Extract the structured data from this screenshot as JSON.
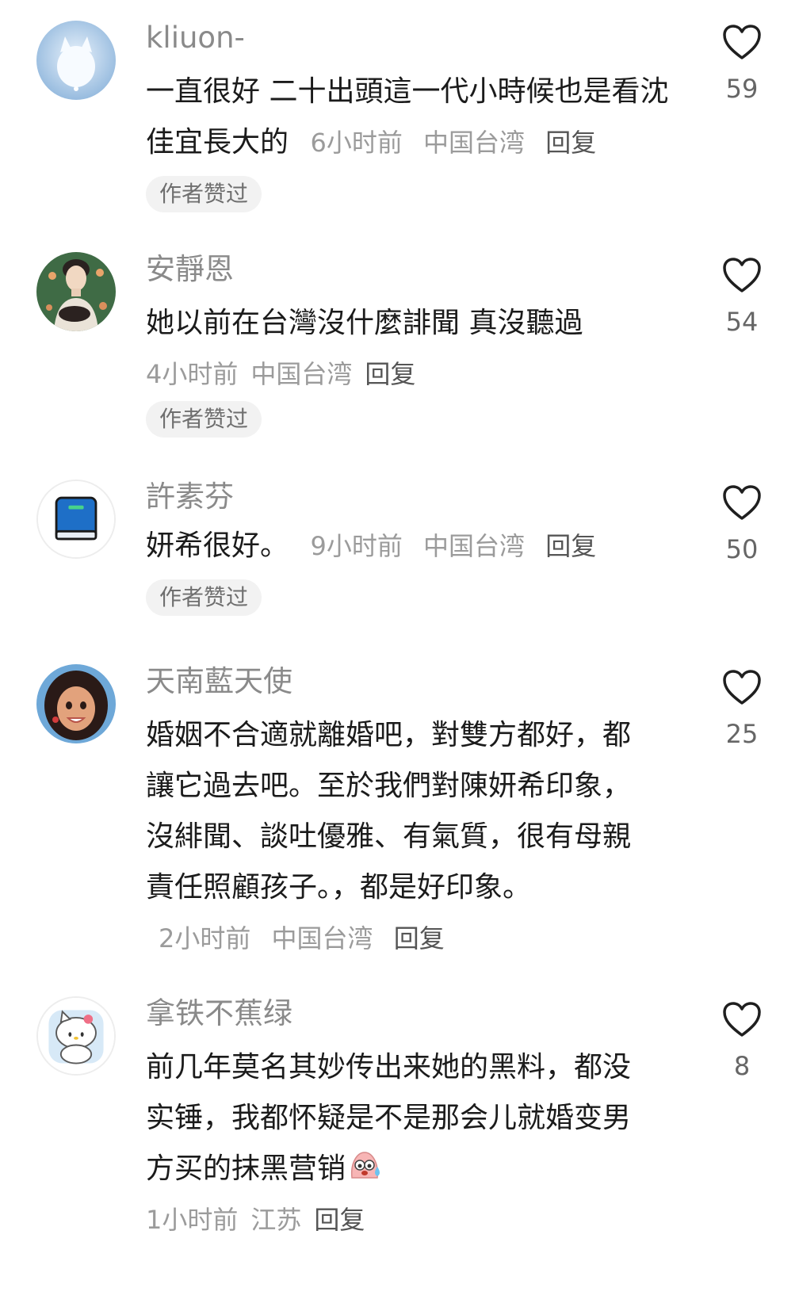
{
  "comments": [
    {
      "username": "kliuon-",
      "text": "一直很好 二十出頭這一代小時候也是看沈佳宜長大的",
      "time": "6小时前",
      "location": "中国台湾",
      "reply_label": "回复",
      "badge": "作者赞过",
      "likes": "59",
      "avatar_icon": "white-cat-avatar"
    },
    {
      "username": "安靜恩",
      "text": "她以前在台灣沒什麼誹聞 真沒聽過",
      "time": "4小时前",
      "location": "中国台湾",
      "reply_label": "回复",
      "badge": "作者赞过",
      "likes": "54",
      "avatar_icon": "woman-painting-avatar"
    },
    {
      "username": "許素芬",
      "text": "妍希很好。",
      "time": "9小时前",
      "location": "中国台湾",
      "reply_label": "回复",
      "badge": "作者赞过",
      "likes": "50",
      "avatar_icon": "blue-book-avatar"
    },
    {
      "username": "天南藍天使",
      "text": "婚姻不合適就離婚吧，對雙方都好，都讓它過去吧。至於我們對陳妍希印象，沒緋聞、談吐優雅、有氣質，很有母親責任照顧孩子。，都是好印象。",
      "time": "2小时前",
      "location": "中国台湾",
      "reply_label": "回复",
      "likes": "25",
      "avatar_icon": "cartoon-girl-avatar"
    },
    {
      "username": "拿铁不蕉绿",
      "text": "前几年莫名其妙传出来她的黑料，都没实锤，我都怀疑是不是那会儿就婚变男方买的抹黑营销",
      "time": "1小时前",
      "location": "江苏",
      "reply_label": "回复",
      "likes": "8",
      "avatar_icon": "hello-kitty-avatar",
      "emoji_icon": "sweating-face-emoji"
    }
  ],
  "colors": {
    "username": "#8a8a8a",
    "text": "#1b1b1b",
    "meta": "#9b9b9b",
    "badge_bg": "#f2f2f2"
  }
}
